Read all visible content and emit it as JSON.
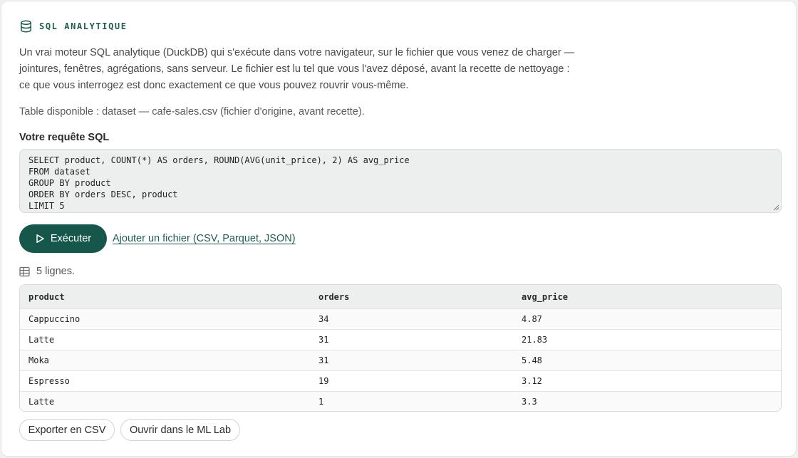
{
  "header": {
    "title": "SQL ANALYTIQUE",
    "icon": "database-icon"
  },
  "description": "Un vrai moteur SQL analytique (DuckDB) qui s'exécute dans votre navigateur, sur le fichier que vous venez de charger — jointures, fenêtres, agrégations, sans serveur. Le fichier est lu tel que vous l'avez déposé, avant la recette de nettoyage : ce que vous interrogez est donc exactement ce que vous pouvez rouvrir vous-même.",
  "table_available": "Table disponible : dataset — cafe-sales.csv (fichier d'origine, avant recette).",
  "sql": {
    "label": "Votre requête SQL",
    "query": "SELECT product, COUNT(*) AS orders, ROUND(AVG(unit_price), 2) AS avg_price\nFROM dataset\nGROUP BY product\nORDER BY orders DESC, product\nLIMIT 5"
  },
  "actions": {
    "run_label": "Exécuter",
    "add_file_label": "Ajouter un fichier (CSV, Parquet, JSON)"
  },
  "results": {
    "count_label": "5 lignes.",
    "columns": [
      "product",
      "orders",
      "avg_price"
    ],
    "rows": [
      [
        "Cappuccino",
        "34",
        "4.87"
      ],
      [
        "Latte",
        "31",
        "21.83"
      ],
      [
        "Moka",
        "31",
        "5.48"
      ],
      [
        "Espresso",
        "19",
        "3.12"
      ],
      [
        "Latte",
        "1",
        "3.3"
      ]
    ]
  },
  "footer": {
    "export_label": "Exporter en CSV",
    "mllab_label": "Ouvrir dans le ML Lab"
  },
  "colors": {
    "accent": "#15574a",
    "accent_text": "#1f5c4e",
    "editor_bg": "#edefee"
  }
}
